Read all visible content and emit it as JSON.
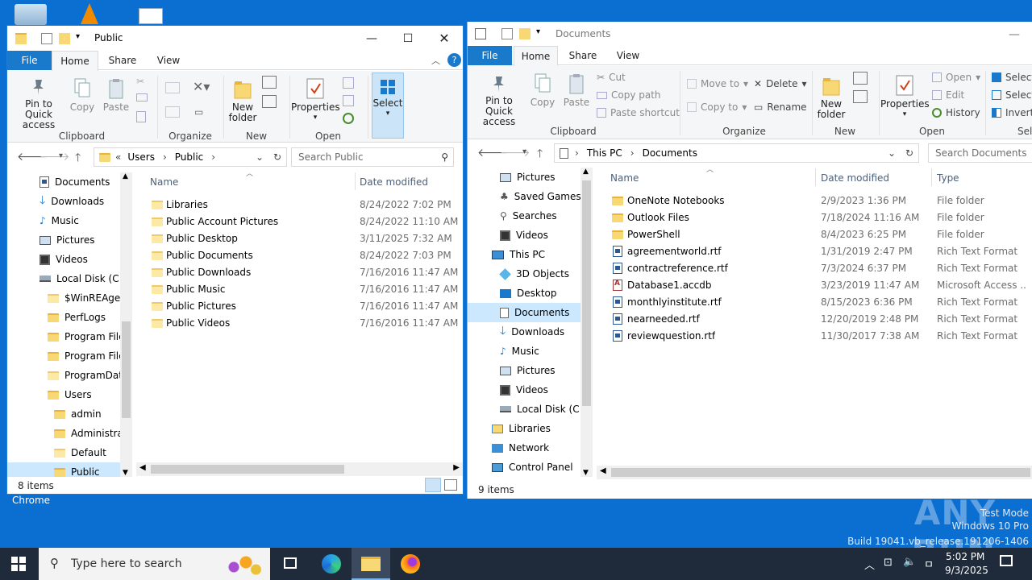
{
  "desktop": {
    "chrome_label": "Chrome"
  },
  "left": {
    "title": "Public",
    "tabs": [
      "File",
      "Home",
      "Share",
      "View"
    ],
    "ribbon": {
      "pin": "Pin to Quick access",
      "copy": "Copy",
      "paste": "Paste",
      "clipboard": "Clipboard",
      "organize": "Organize",
      "new_folder": "New folder",
      "new": "New",
      "properties": "Properties",
      "open": "Open",
      "select": "Select"
    },
    "breadcrumb": {
      "prefix": "«",
      "items": [
        "Users",
        "Public"
      ]
    },
    "search_placeholder": "Search Public",
    "nav": [
      "Documents",
      "Downloads",
      "Music",
      "Pictures",
      "Videos",
      "Local Disk (C:)",
      "$WinREAgent",
      "PerfLogs",
      "Program Files",
      "Program Files",
      "ProgramData",
      "Users",
      "admin",
      "Administrat",
      "Default",
      "Public"
    ],
    "columns": {
      "name": "Name",
      "date": "Date modified"
    },
    "files": [
      {
        "name": "Libraries",
        "date": "8/24/2022 7:02 PM"
      },
      {
        "name": "Public Account Pictures",
        "date": "8/24/2022 11:10 AM"
      },
      {
        "name": "Public Desktop",
        "date": "3/11/2025 7:32 AM"
      },
      {
        "name": "Public Documents",
        "date": "8/24/2022 7:03 PM"
      },
      {
        "name": "Public Downloads",
        "date": "7/16/2016 11:47 AM"
      },
      {
        "name": "Public Music",
        "date": "7/16/2016 11:47 AM"
      },
      {
        "name": "Public Pictures",
        "date": "7/16/2016 11:47 AM"
      },
      {
        "name": "Public Videos",
        "date": "7/16/2016 11:47 AM"
      }
    ],
    "status": "8 items"
  },
  "right": {
    "title": "Documents",
    "tabs": [
      "File",
      "Home",
      "Share",
      "View"
    ],
    "ribbon": {
      "pin": "Pin to Quick access",
      "copy": "Copy",
      "paste": "Paste",
      "cut": "Cut",
      "copy_path": "Copy path",
      "paste_shortcut": "Paste shortcut",
      "clipboard": "Clipboard",
      "move_to": "Move to",
      "copy_to": "Copy to",
      "delete": "Delete",
      "rename": "Rename",
      "organize": "Organize",
      "new_folder": "New folder",
      "new": "New",
      "properties": "Properties",
      "open_small": "Open",
      "edit": "Edit",
      "history": "History",
      "open": "Open",
      "select_all": "Select",
      "select_none": "Select",
      "invert": "Invert",
      "sel_group": "Sel"
    },
    "breadcrumb": {
      "items": [
        "This PC",
        "Documents"
      ]
    },
    "search_placeholder": "Search Documents",
    "nav": [
      "Pictures",
      "Saved Games",
      "Searches",
      "Videos",
      "This PC",
      "3D Objects",
      "Desktop",
      "Documents",
      "Downloads",
      "Music",
      "Pictures",
      "Videos",
      "Local Disk (C:)",
      "Libraries",
      "Network",
      "Control Panel"
    ],
    "columns": {
      "name": "Name",
      "date": "Date modified",
      "type": "Type"
    },
    "files": [
      {
        "name": "OneNote Notebooks",
        "date": "2/9/2023 1:36 PM",
        "type": "File folder",
        "kind": "folder"
      },
      {
        "name": "Outlook Files",
        "date": "7/18/2024 11:16 AM",
        "type": "File folder",
        "kind": "folder"
      },
      {
        "name": "PowerShell",
        "date": "8/4/2023 6:25 PM",
        "type": "File folder",
        "kind": "folder"
      },
      {
        "name": "agreementworld.rtf",
        "date": "1/31/2019 2:47 PM",
        "type": "Rich Text Format",
        "kind": "doc"
      },
      {
        "name": "contractreference.rtf",
        "date": "7/3/2024 6:37 PM",
        "type": "Rich Text Format",
        "kind": "doc"
      },
      {
        "name": "Database1.accdb",
        "date": "3/23/2019 11:47 AM",
        "type": "Microsoft Access ...",
        "kind": "access"
      },
      {
        "name": "monthlyinstitute.rtf",
        "date": "8/15/2023 6:36 PM",
        "type": "Rich Text Format",
        "kind": "doc"
      },
      {
        "name": "nearneeded.rtf",
        "date": "12/20/2019 2:48 PM",
        "type": "Rich Text Format",
        "kind": "doc"
      },
      {
        "name": "reviewquestion.rtf",
        "date": "11/30/2017 7:38 AM",
        "type": "Rich Text Format",
        "kind": "doc"
      }
    ],
    "status": "9 items"
  },
  "taskbar": {
    "search_placeholder": "Type here to search",
    "time": "5:02 PM",
    "date": "9/3/2025"
  },
  "watermark": {
    "brand": "ANY RUN",
    "line1": "Test Mode",
    "line2": "Windows 10 Pro",
    "line3": "Build 19041.vb_release.191206-1406"
  }
}
